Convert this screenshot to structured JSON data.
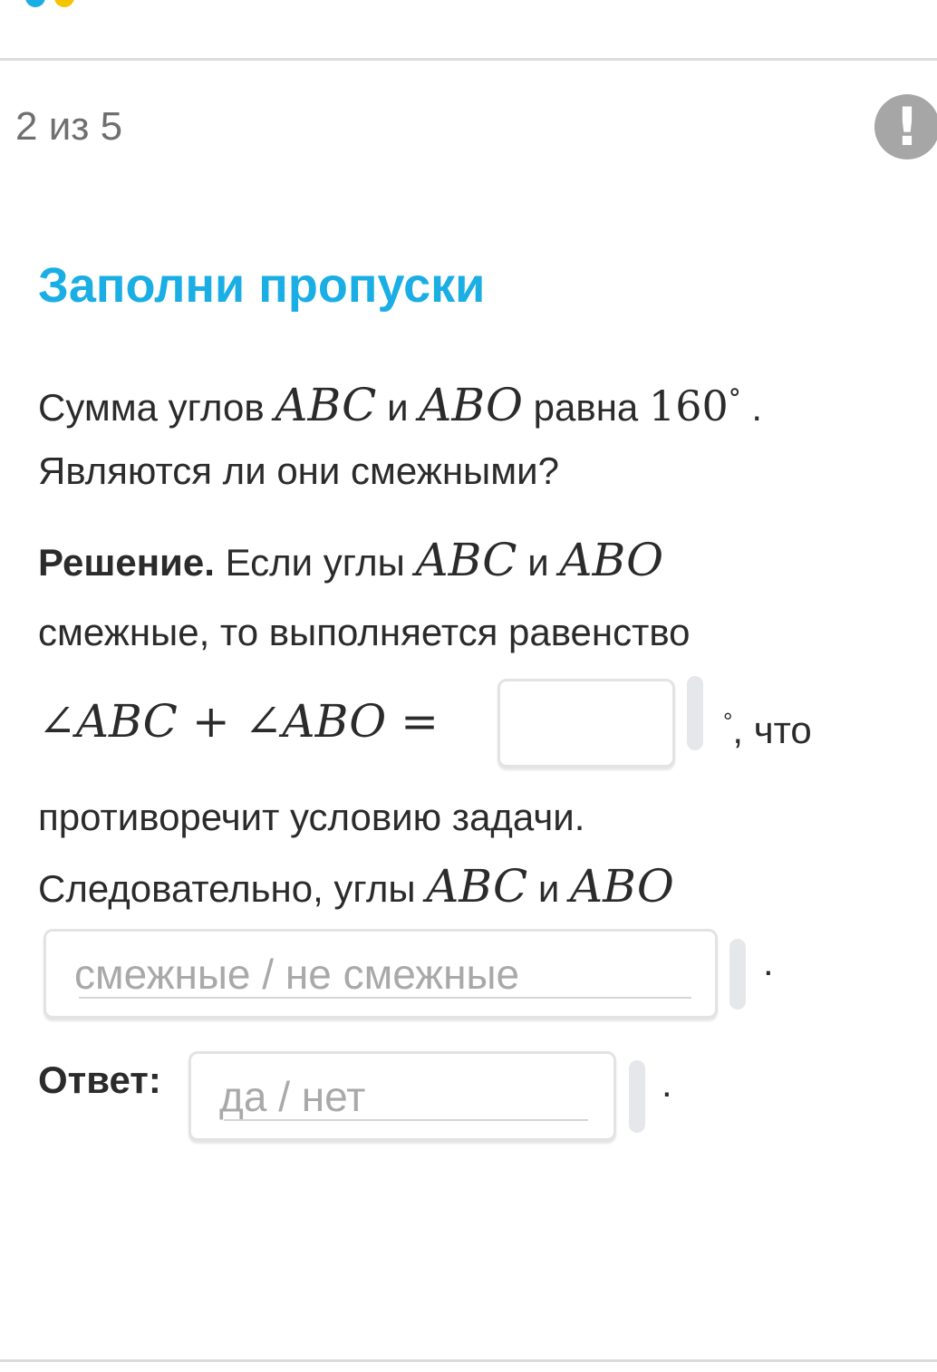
{
  "header": {
    "progress_text": "2 из 5",
    "report_icon": "exclamation-icon",
    "report_glyph": "!"
  },
  "task": {
    "title": "Заполни пропуски",
    "title_color": "#1aaee5",
    "q1_a": "Сумма углов ",
    "angle_abc": "ABC",
    "conj": " и ",
    "angle_abo": "ABO",
    "q1_b": " равна ",
    "sum_value": "160",
    "deg": "°",
    "q1_end": " .",
    "q2": "Являются ли они смежными?",
    "sol_label": "Решение.",
    "sol_a": " Если углы ",
    "sol_line2": "смежные, то выполняется равенство",
    "eq_left": "∠ABC + ∠ABO =",
    "eq_after": ", что",
    "line_contradiction": "противоречит условию задачи.",
    "conclusion_a": "Следовательно, углы ",
    "dropdown_placeholder": "смежные / не смежные",
    "period": ".",
    "answer_label": "Ответ:",
    "answer_placeholder": "да / нет"
  }
}
